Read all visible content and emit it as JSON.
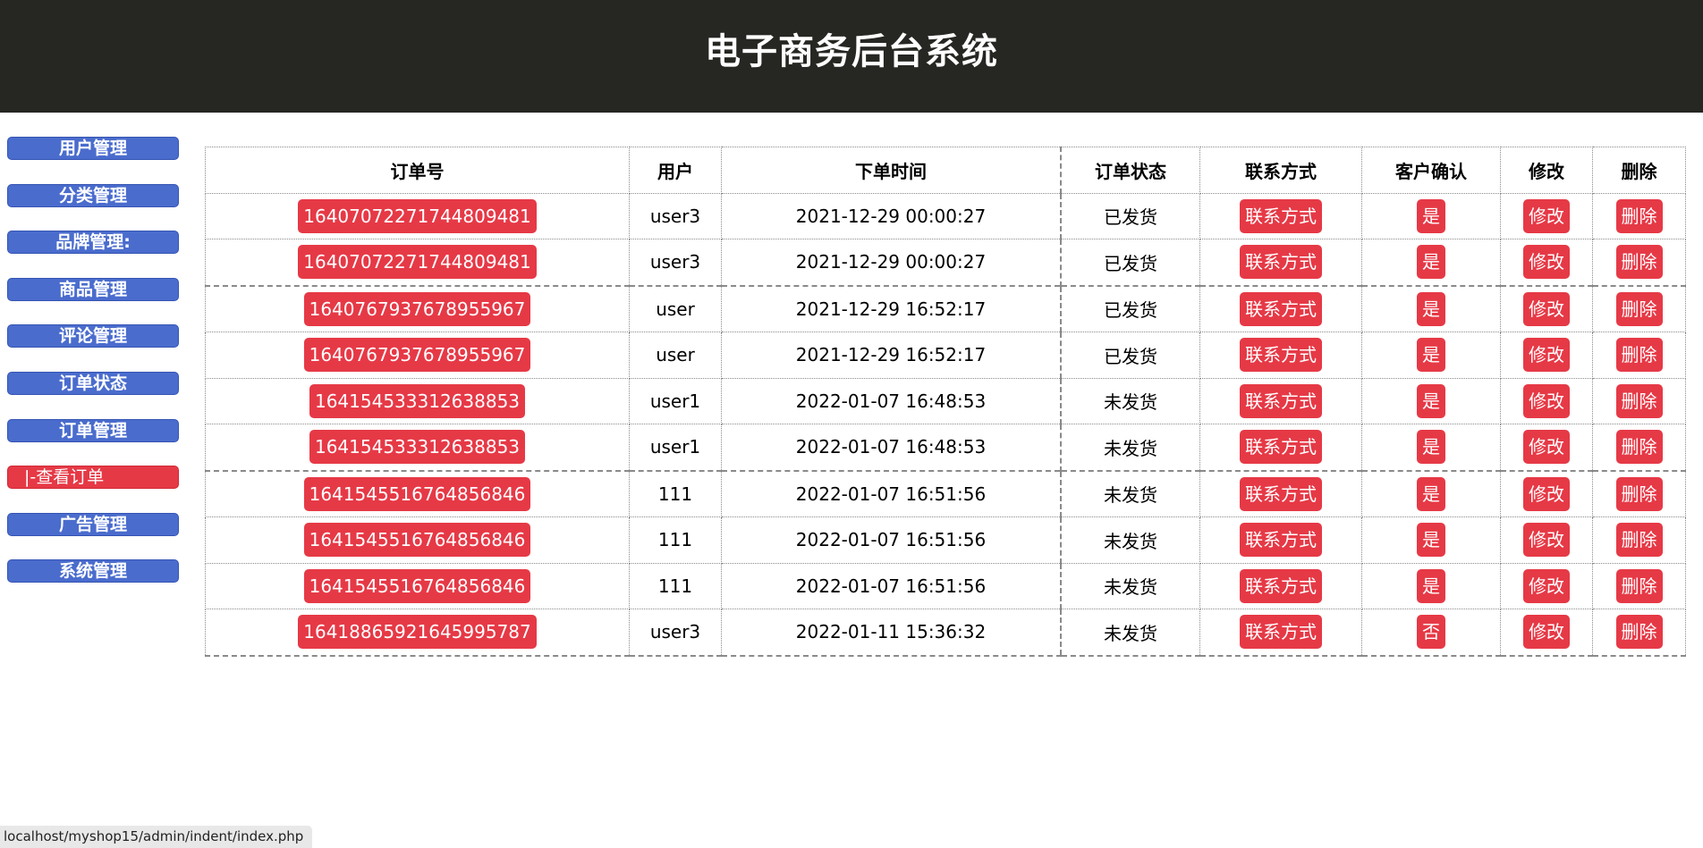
{
  "header": {
    "title": "电子商务后台系统"
  },
  "sidebar": {
    "items": [
      {
        "label": "用户管理",
        "name": "sidebar-item-user-management",
        "active": false
      },
      {
        "label": "分类管理",
        "name": "sidebar-item-category-management",
        "active": false
      },
      {
        "label": "品牌管理:",
        "name": "sidebar-item-brand-management",
        "active": false
      },
      {
        "label": "商品管理",
        "name": "sidebar-item-product-management",
        "active": false
      },
      {
        "label": "评论管理",
        "name": "sidebar-item-comment-management",
        "active": false
      },
      {
        "label": "订单状态",
        "name": "sidebar-item-order-status",
        "active": false
      },
      {
        "label": "订单管理",
        "name": "sidebar-item-order-management",
        "active": false
      },
      {
        "label": "|-查看订单",
        "name": "sidebar-item-view-orders",
        "active": true
      },
      {
        "label": "广告管理",
        "name": "sidebar-item-ad-management",
        "active": false
      },
      {
        "label": "系统管理",
        "name": "sidebar-item-system-management",
        "active": false
      }
    ]
  },
  "table": {
    "headers": [
      "订单号",
      "用户",
      "下单时间",
      "订单状态",
      "联系方式",
      "客户确认",
      "修改",
      "删除"
    ],
    "contact_label": "联系方式",
    "edit_label": "修改",
    "delete_label": "删除",
    "rows": [
      {
        "order_no": "16407072271744809481",
        "user": "user3",
        "time": "2021-12-29 00:00:27",
        "status": "已发货",
        "confirm": "是"
      },
      {
        "order_no": "16407072271744809481",
        "user": "user3",
        "time": "2021-12-29 00:00:27",
        "status": "已发货",
        "confirm": "是"
      },
      {
        "order_no": "1640767937678955967",
        "user": "user",
        "time": "2021-12-29 16:52:17",
        "status": "已发货",
        "confirm": "是"
      },
      {
        "order_no": "1640767937678955967",
        "user": "user",
        "time": "2021-12-29 16:52:17",
        "status": "已发货",
        "confirm": "是"
      },
      {
        "order_no": "164154533312638853",
        "user": "user1",
        "time": "2022-01-07 16:48:53",
        "status": "未发货",
        "confirm": "是"
      },
      {
        "order_no": "164154533312638853",
        "user": "user1",
        "time": "2022-01-07 16:48:53",
        "status": "未发货",
        "confirm": "是"
      },
      {
        "order_no": "1641545516764856846",
        "user": "111",
        "time": "2022-01-07 16:51:56",
        "status": "未发货",
        "confirm": "是"
      },
      {
        "order_no": "1641545516764856846",
        "user": "111",
        "time": "2022-01-07 16:51:56",
        "status": "未发货",
        "confirm": "是"
      },
      {
        "order_no": "1641545516764856846",
        "user": "111",
        "time": "2022-01-07 16:51:56",
        "status": "未发货",
        "confirm": "是"
      },
      {
        "order_no": "16418865921645995787",
        "user": "user3",
        "time": "2022-01-11 15:36:32",
        "status": "未发货",
        "confirm": "否"
      }
    ]
  },
  "statusbar": {
    "url": "localhost/myshop15/admin/indent/index.php"
  },
  "colors": {
    "header_bg": "#262622",
    "sidebar_blue": "#4a6ccd",
    "accent_red": "#e63946"
  }
}
